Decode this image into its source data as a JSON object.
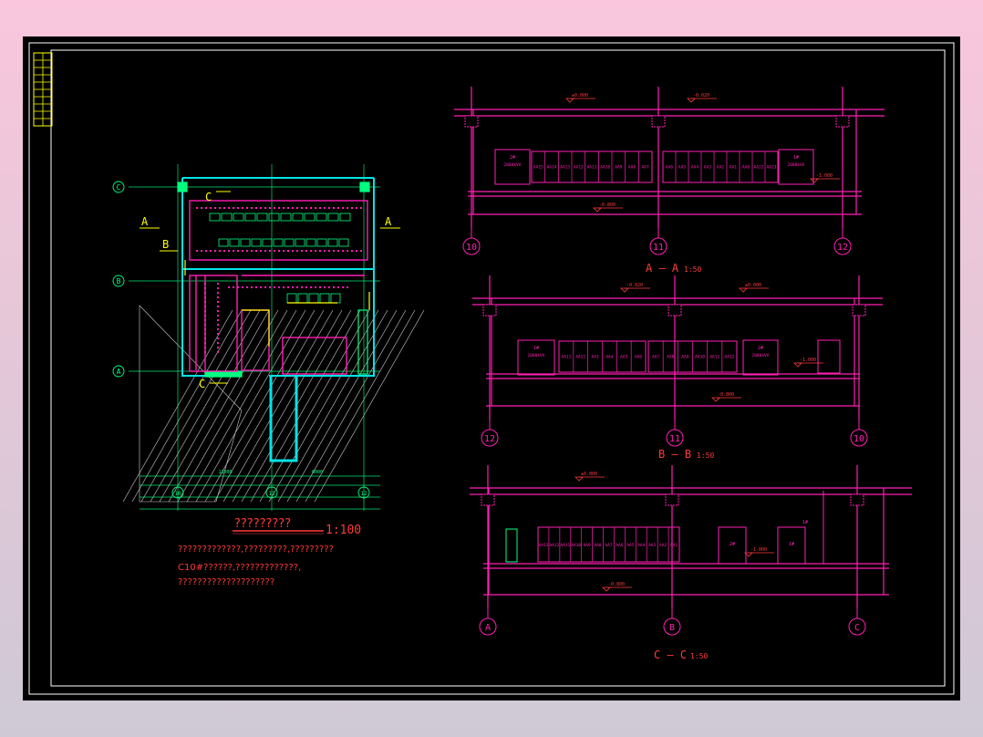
{
  "colors": {
    "background": "#000000",
    "frame": "#ffffff",
    "wall": "#ff1fb4",
    "grid_line": "#00ff80",
    "equipment": "#ff2a6e",
    "title_block": "#ffff00",
    "text_red": "#ff3a3a",
    "wall_cyan": "#00e5e5"
  },
  "plan": {
    "title": "?????????",
    "scale": "1:100",
    "grid_rows": [
      "C",
      "B",
      "A"
    ],
    "grid_cols": [
      "10",
      "11",
      "12"
    ],
    "section_marks": [
      "A",
      "A",
      "B",
      "C",
      "C"
    ],
    "dim_left": "12000",
    "dim_right": "6000",
    "notes": [
      "?????????????,?????????,?????????",
      "C10#??????,?????????????,",
      "????????????????????"
    ]
  },
  "sections": [
    {
      "id": "A-A",
      "title": "A — A",
      "scale": "1:50",
      "axes": [
        "10",
        "11",
        "12"
      ],
      "levels": [
        "±0.000",
        "-0.020",
        "-0.800",
        "-1.000"
      ],
      "transformers": [
        {
          "label": "2#",
          "capacity": "2000kVA"
        },
        {
          "label": "1#",
          "capacity": "2000kVA"
        }
      ],
      "panels_left": [
        "AA15",
        "AA14",
        "AA13",
        "AA12",
        "AA11",
        "AA10",
        "AA9",
        "AA8",
        "AA7"
      ],
      "panels_right": [
        "AA6",
        "AA5",
        "AA4",
        "AA3",
        "AA2",
        "AA1",
        "AA0",
        "AA22",
        "AA23"
      ],
      "note": "AA4a-1"
    },
    {
      "id": "B-B",
      "title": "B — B",
      "scale": "1:50",
      "axes": [
        "12",
        "11",
        "10"
      ],
      "levels": [
        "-0.020",
        "±0.000",
        "-1.000",
        "-0.800"
      ],
      "transformers": [
        {
          "label": "1#",
          "capacity": "2000kVA"
        },
        {
          "label": "2#",
          "capacity": "2000kVA"
        }
      ],
      "panels_left": [
        "AA11",
        "AA21",
        "AA3",
        "AA4",
        "AA5",
        "AA6"
      ],
      "panels_right": [
        "AA7",
        "AA8",
        "AA9",
        "AA10",
        "AA11",
        "AA12"
      ]
    },
    {
      "id": "C-C",
      "title": "C — C",
      "scale": "1:50",
      "axes": [
        "A",
        "B",
        "C"
      ],
      "levels": [
        "±0.000",
        "-1.000",
        "-0.800"
      ],
      "panels": [
        "AA13",
        "AA12",
        "AA11",
        "AA10",
        "AA9",
        "AA8",
        "AA7",
        "AA6",
        "AA5",
        "AA4",
        "AA3",
        "AA2",
        "AA1"
      ],
      "boxes": [
        {
          "label": "2#"
        },
        {
          "label": "1#"
        }
      ],
      "door_label": "1#"
    }
  ]
}
